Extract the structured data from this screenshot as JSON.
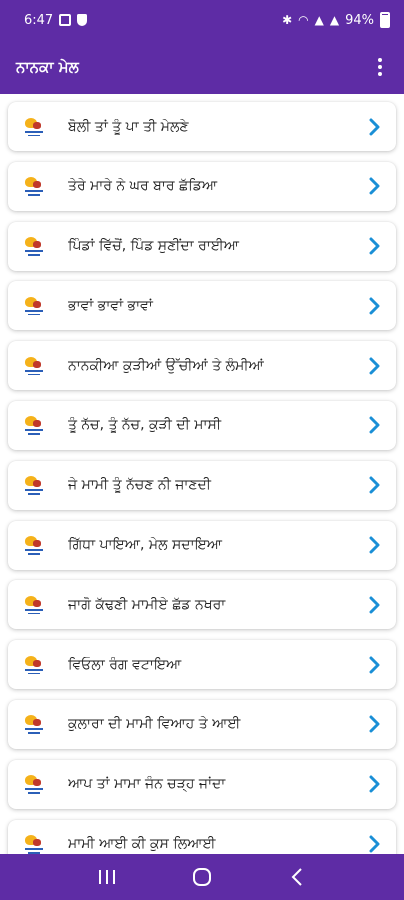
{
  "status": {
    "time": "6:47",
    "battery": "94%"
  },
  "app_bar": {
    "title": "ਨਾਨਕਾ ਮੇਲ"
  },
  "items": [
    {
      "label": "ਬੋਲੀ ਤਾਂ ਤੂੰ ਪਾ ਤੀ ਮੇਲਣੇ"
    },
    {
      "label": "ਤੇਰੇ ਮਾਰੇ ਨੇ ਘਰ ਬਾਰ ਛੱਡਿਆ"
    },
    {
      "label": "ਪਿੰਡਾਂ ਵਿੱਚੋਂ, ਪਿੰਡ ਸੁਣੀਂਦਾ ਰਾਈਆ"
    },
    {
      "label": "ਭਾਵਾਂ ਭਾਵਾਂ ਭਾਵਾਂ"
    },
    {
      "label": "ਨਾਨਕੀਆ ਕੁੜੀਆਂ ਉੱਚੀਆਂ ਤੇ ਲੰਮੀਆਂ"
    },
    {
      "label": "ਤੂੰ ਨੱਚ, ਤੂੰ ਨੱਚ, ਕੁੜੀ ਦੀ ਮਾਸੀ"
    },
    {
      "label": "ਜੇ ਮਾਮੀ ਤੂੰ ਨੱਚਣ ਨੀ ਜਾਣਦੀ"
    },
    {
      "label": "ਗਿੱਧਾ ਪਾਇਆ, ਮੇਲ ਸਦਾਇਆ"
    },
    {
      "label": "ਜਾਗੋ ਕੱਢਣੀ ਮਾਮੀਏ ਛੱਡ ਨਖਰਾ"
    },
    {
      "label": "ਵਿਓਲਾ ਰੰਗ ਵਟਾਇਆ"
    },
    {
      "label": "ਕੁਲਾਰਾ ਦੀ ਮਾਮੀ ਵਿਆਹ ਤੇ ਆਈ"
    },
    {
      "label": "ਆਪ ਤਾਂ ਮਾਮਾ ਜੰਨ ਚੜ੍ਹ ਜਾਂਦਾ"
    },
    {
      "label": "ਮਾਮੀ ਆਈ ਕੀ ਕੁਸ ਲਿਆਈ"
    }
  ],
  "colors": {
    "primary": "#5e2ca5",
    "chevron": "#1a8fd6"
  },
  "icons": {
    "menu": "overflow-menu-icon",
    "chevron": "chevron-right-icon",
    "thumbnail": "dancer-thumbnail-icon",
    "nav_recents": "recents-icon",
    "nav_home": "home-icon",
    "nav_back": "back-icon"
  }
}
